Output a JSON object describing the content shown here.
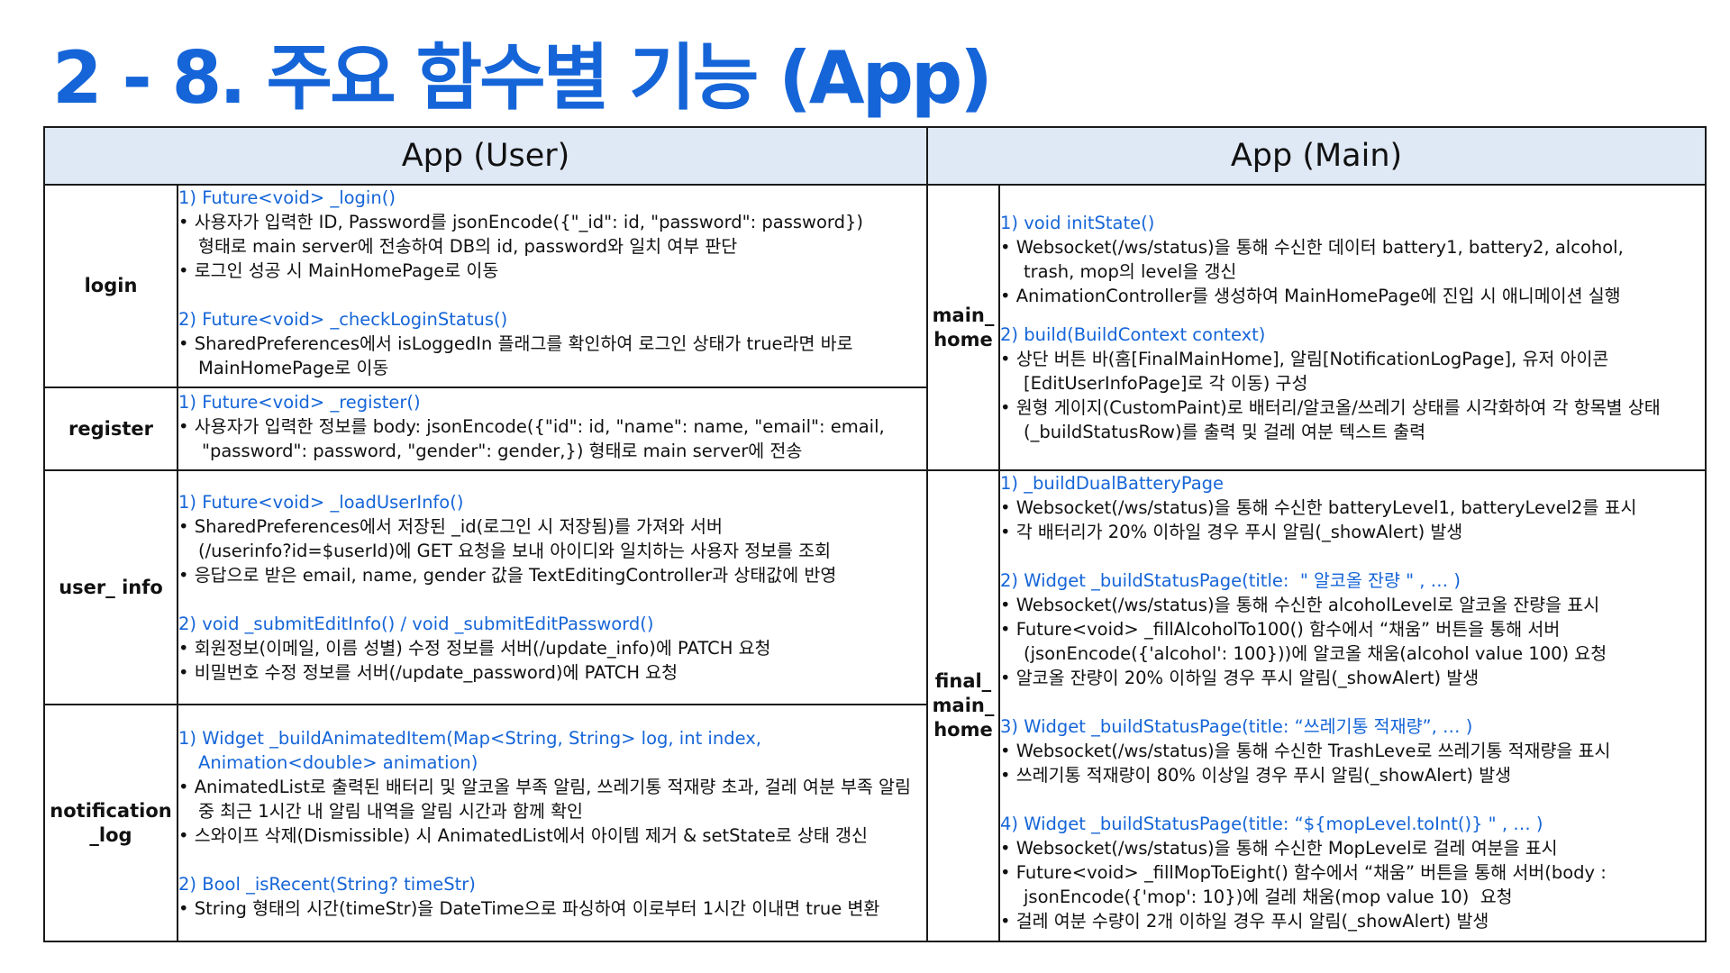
{
  "title": "2 - 8. 주요 함수별 기능 (App)",
  "headers": {
    "user": "App (User)",
    "main": "App (Main)"
  },
  "sections": {
    "login": {
      "label": "login",
      "lines": [
        "1) Future<void> _login()",
        "• 사용자가 입력한 ID, Password를 jsonEncode({\"_id\": id, \"password\": password})",
        "형태로 main server에 전송하여 DB의 id, password와 일치 여부 판단",
        "• 로그인 성공 시 MainHomePage로 이동",
        "2) Future<void> _checkLoginStatus()",
        "• SharedPreferences에서 isLoggedIn 플래그를 확인하여 로그인 상태가 true라면 바로",
        "MainHomePage로 이동"
      ]
    },
    "register": {
      "label": "register",
      "lines": [
        "1) Future<void> _register()",
        "• 사용자가 입력한 정보를 body: jsonEncode({\"id\": id, \"name\": name, \"email\": email,",
        "\"password\": password, \"gender\": gender,}) 형태로 main server에 전송"
      ]
    },
    "user_info": {
      "label": "user_ info",
      "lines": [
        "1) Future<void> _loadUserInfo()",
        "• SharedPreferences에서 저장된 _id(로그인 시 저장됨)를 가져와 서버",
        "(/userinfo?id=$userId)에 GET 요청을 보내 아이디와 일치하는 사용자 정보를 조회",
        "• 응답으로 받은 email, name, gender 값을 TextEditingController과 상태값에 반영",
        "2) void _submitEditInfo() / void _submitEditPassword()",
        "• 회원정보(이메일, 이름 성별) 수정 정보를 서버(/update_info)에 PATCH 요청",
        "• 비밀번호 수정 정보를 서버(/update_password)에 PATCH 요청"
      ]
    },
    "notification_log": {
      "label_line1": "notification",
      "label_line2": "_log",
      "lines": [
        "1) Widget _buildAnimatedItem(Map<String, String> log, int index,",
        "Animation<double> animation)",
        "• AnimatedList로 출력된 배터리 및 알코올 부족 알림, 쓰레기통 적재량 초과, 걸레 여분 부족 알림",
        "중 최근 1시간 내 알림 내역을 알림 시간과 함께 확인",
        "• 스와이프 삭제(Dismissible) 시 AnimatedList에서 아이템 제거 & setState로 상태 갱신",
        "2) Bool _isRecent(String? timeStr)",
        "• String 형태의 시간(timeStr)을 DateTime으로 파싱하여 이로부터 1시간 이내면 true 변환"
      ]
    },
    "main_home": {
      "label_line1": "main_",
      "label_line2": "home",
      "lines": [
        "1) void initState()",
        "• Websocket(/ws/status)을 통해 수신한 데이터 battery1, battery2, alcohol,",
        "trash, mop의 level을 갱신",
        "• AnimationController를 생성하여 MainHomePage에 진입 시 애니메이션 실행",
        "2) build(BuildContext context)",
        "• 상단 버튼 바(홈[FinalMainHome], 알림[NotificationLogPage], 유저 아이콘",
        "[EditUserInfoPage]로 각 이동) 구성",
        "• 원형 게이지(CustomPaint)로 배터리/알코올/쓰레기 상태를 시각화하여 각 항목별 상태",
        "(_buildStatusRow)를 출력 및 걸레 여분 텍스트 출력"
      ]
    },
    "final_main_home": {
      "label_line1": "final_",
      "label_line2": "main_",
      "label_line3": "home",
      "lines": [
        "1) _buildDualBatteryPage",
        "• Websocket(/ws/status)을 통해 수신한 batteryLevel1, batteryLevel2를 표시",
        "• 각 배터리가 20% 이하일 경우 푸시 알림(_showAlert) 발생",
        "2) Widget _buildStatusPage(title:  \" 알코올 잔량 \" , … )",
        "• Websocket(/ws/status)을 통해 수신한 alcoholLevel로 알코올 잔량을 표시",
        "• Future<void> _fillAlcoholTo100() 함수에서 “채움” 버튼을 통해 서버",
        "(jsonEncode({'alcohol': 100}))에 알코올 채움(alcohol value 100) 요청",
        "• 알코올 잔량이 20% 이하일 경우 푸시 알림(_showAlert) 발생",
        "3) Widget _buildStatusPage(title: “쓰레기통 적재량”, … )",
        "• Websocket(/ws/status)을 통해 수신한 TrashLeve로 쓰레기통 적재량을 표시",
        "• 쓰레기통 적재량이 80% 이상일 경우 푸시 알림(_showAlert) 발생",
        "4) Widget _buildStatusPage(title: “${mopLevel.toInt()} \" , … )",
        "• Websocket(/ws/status)을 통해 수신한 MopLevel로 걸레 여분을 표시",
        "• Future<void> _fillMopToEight() 함수에서 “채움” 버튼을 통해 서버(body :",
        "jsonEncode({'mop': 10})에 걸레 채움(mop value 10)  요청",
        "• 걸레 여분 수량이 2개 이하일 경우 푸시 알림(_showAlert) 발생"
      ]
    }
  }
}
